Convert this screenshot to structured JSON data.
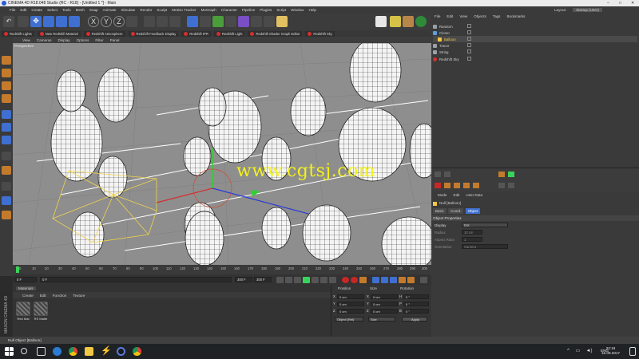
{
  "window": {
    "title": "CINEMA 4D R18.048 Studio (RC - R18) - [Untitled 1 *] - Main"
  },
  "menubar": {
    "items": [
      "File",
      "Edit",
      "Create",
      "Select",
      "Tools",
      "Mesh",
      "Snap",
      "Animate",
      "Simulate",
      "Render",
      "Sculpt",
      "Motion Tracker",
      "MoGraph",
      "Character",
      "Pipeline",
      "Plugins",
      "Script",
      "Window",
      "Help"
    ]
  },
  "layout": {
    "label": "Layout:",
    "value": "Startup (User)"
  },
  "redshift_bar": {
    "items": [
      "Redshift Lights",
      "New Redshift Material",
      "Redshift Atmosphere",
      "Redshift Feedback Display",
      "Redshift IPR",
      "Redshift Light",
      "Redshift Shader Graph Editor",
      "Redshift Sky"
    ]
  },
  "viewport": {
    "menu": [
      "View",
      "Cameras",
      "Display",
      "Options",
      "Filter",
      "Panel"
    ],
    "label": "Perspective",
    "watermark": "www.cgtsj.com"
  },
  "timeline": {
    "ticks": [
      "0",
      "10",
      "20",
      "30",
      "40",
      "50",
      "60",
      "70",
      "80",
      "90",
      "100",
      "110",
      "120",
      "130",
      "140",
      "150",
      "160",
      "170",
      "180",
      "190",
      "200",
      "210",
      "220",
      "230",
      "240",
      "250",
      "260",
      "270",
      "280",
      "290",
      "300"
    ],
    "start_field": "0 F",
    "current_field": "0 F",
    "end_field": "300 F",
    "end_field2": "300 F"
  },
  "materials": {
    "header": "Materials",
    "menu": [
      "Create",
      "Edit",
      "Function",
      "Texture"
    ],
    "items": [
      "Red Mat",
      "RS Matte"
    ],
    "brand": "MAXON CINEMA 4D"
  },
  "coordinates": {
    "headers": [
      "Position",
      "Size",
      "Rotation"
    ],
    "rows": [
      {
        "axis": "X",
        "pos": "0 cm",
        "size_axis": "X",
        "size": "0 cm",
        "rot_axis": "H",
        "rot": "0 °"
      },
      {
        "axis": "Y",
        "pos": "0 cm",
        "size_axis": "Y",
        "size": "0 cm",
        "rot_axis": "P",
        "rot": "0 °"
      },
      {
        "axis": "Z",
        "pos": "0 cm",
        "size_axis": "Z",
        "size": "0 cm",
        "rot_axis": "B",
        "rot": "0 °"
      }
    ],
    "mode": "Object (Rel)",
    "size_mode": "Size",
    "apply": "Apply"
  },
  "object_manager": {
    "menu": [
      "File",
      "Edit",
      "View",
      "Objects",
      "Tags",
      "Bookmarks"
    ],
    "objects": [
      {
        "name": "Random",
        "color": "#9aa0a6"
      },
      {
        "name": "Cloner",
        "color": "#5aa0e0"
      },
      {
        "name": "Balloon",
        "color": "#f2c744"
      },
      {
        "name": "Tracer",
        "color": "#9aa0a6"
      },
      {
        "name": "String",
        "color": "#9aa0a6"
      },
      {
        "name": "Redshift Sky",
        "color": "#d32f2f"
      }
    ]
  },
  "attributes": {
    "menu": [
      "Mode",
      "Edit",
      "User Data"
    ],
    "object_title": "Null [Balloon]",
    "tabs": [
      "Basic",
      "Coord.",
      "Object"
    ],
    "section": "Object Properties",
    "props": [
      {
        "label": "Display",
        "value": "Dot"
      },
      {
        "label": "Radius",
        "value": "10 cm"
      },
      {
        "label": "Aspect Ratio",
        "value": "1"
      },
      {
        "label": "Orientation",
        "value": "Camera"
      }
    ]
  },
  "status": {
    "text": "Null Object [Balloon]"
  },
  "taskbar": {
    "lang": "ENG",
    "time": "22:16",
    "date": "15.09.2017"
  }
}
